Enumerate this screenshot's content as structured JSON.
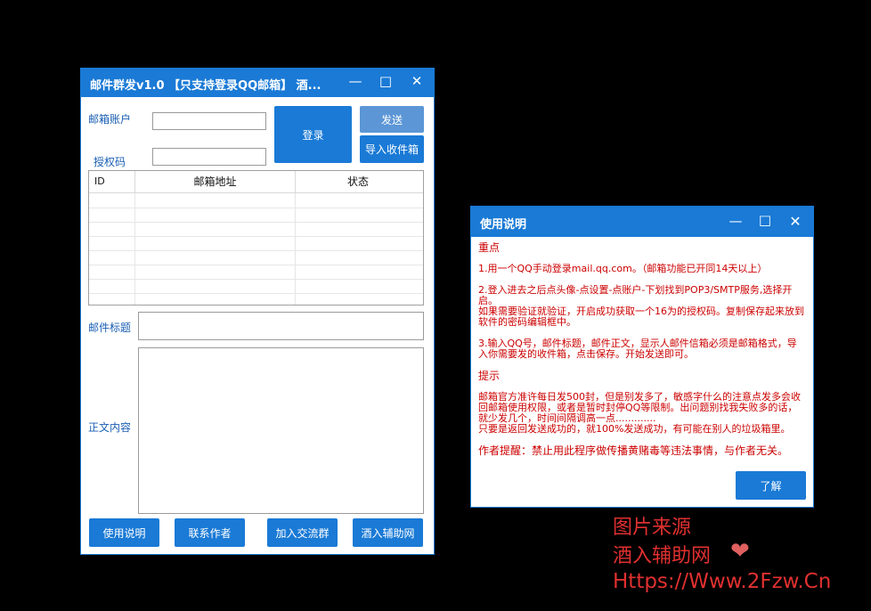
{
  "main_window": {
    "title": "邮件群发v1.0 【只支持登录QQ邮箱】 酒...",
    "controls": {
      "minimize": "—",
      "maximize": "□",
      "close": "✕"
    },
    "account_label": "邮箱账户",
    "account_value": "",
    "auth_label": "授权码",
    "auth_value": "",
    "login_button": "登录",
    "send_button": "发送",
    "import_button": "导入收件箱",
    "table": {
      "columns": [
        "ID",
        "邮箱地址",
        "状态"
      ],
      "rows": [
        [
          "",
          "",
          ""
        ],
        [
          "",
          "",
          ""
        ],
        [
          "",
          "",
          ""
        ],
        [
          "",
          "",
          ""
        ],
        [
          "",
          "",
          ""
        ],
        [
          "",
          "",
          ""
        ],
        [
          "",
          "",
          ""
        ],
        [
          "",
          "",
          ""
        ]
      ]
    },
    "subject_label": "邮件标题",
    "subject_value": "",
    "body_label": "正文内容",
    "body_value": "",
    "bottom_buttons": [
      "使用说明",
      "联系作者",
      "加入交流群",
      "酒入辅助网"
    ]
  },
  "help_window": {
    "title": "使用说明",
    "controls": {
      "minimize": "—",
      "maximize": "□",
      "close": "✕"
    },
    "paragraphs": [
      "重点",
      "1.用一个QQ手动登录mail.qq.com。（邮箱功能已开同14天以上）",
      "2.登入进去之后点头像-点设置-点账户-下划找到POP3/SMTP服务,选择开启。\n如果需要验证就验证，开启成功获取一个16为的授权码。复制保存起来放到软件的密码编辑框中。",
      "3.输入QQ号，邮件标题，邮件正文，显示人邮件信箱必须是邮箱格式，导入你需要发的收件箱，点击保存。开始发送即可。",
      "提示",
      "邮箱官方准许每日发500封，但是别发多了，敏感字什么的注意点发多会收回邮箱使用权限，或者是暂时封停QQ等限制。出问题别找我失败多的话，就少发几个，时间间隔调高一点.............\n只要是返回发送成功的，就100%发送成功，有可能在别人的垃圾箱里。",
      "作者提醒：禁止用此程序做传播黄赌毒等违法事情，与作者无关。"
    ],
    "ok_button": "了解"
  },
  "watermark": {
    "line1": "图片来源",
    "line2": "酒入辅助网",
    "line3": "Https://Www.2Fzw.Cn",
    "heart": "❤"
  },
  "colors": {
    "accent": "#1a7ad6",
    "label": "#1a5fb4",
    "warning_text": "#cc0000",
    "watermark": "#e03030"
  }
}
